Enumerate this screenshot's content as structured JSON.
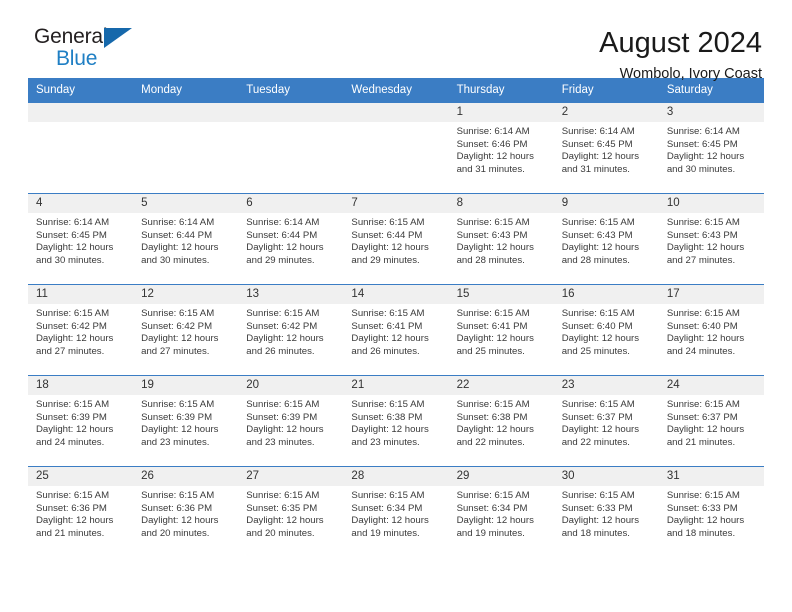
{
  "brand": {
    "name_top": "General",
    "name_bottom": "Blue",
    "triangle_color": "#1668ab",
    "blue_text_color": "#1f7fc4"
  },
  "header": {
    "title": "August 2024",
    "subtitle": "Wombolo, Ivory Coast",
    "accent_color": "#3b7dc4",
    "header_text_color": "#ffffff",
    "daynum_bg": "#f0f0f0"
  },
  "calendar": {
    "weekday_headers": [
      "Sunday",
      "Monday",
      "Tuesday",
      "Wednesday",
      "Thursday",
      "Friday",
      "Saturday"
    ],
    "weeks": [
      [
        {
          "day": "",
          "lines": []
        },
        {
          "day": "",
          "lines": []
        },
        {
          "day": "",
          "lines": []
        },
        {
          "day": "",
          "lines": []
        },
        {
          "day": "1",
          "lines": [
            "Sunrise: 6:14 AM",
            "Sunset: 6:46 PM",
            "Daylight: 12 hours",
            "and 31 minutes."
          ]
        },
        {
          "day": "2",
          "lines": [
            "Sunrise: 6:14 AM",
            "Sunset: 6:45 PM",
            "Daylight: 12 hours",
            "and 31 minutes."
          ]
        },
        {
          "day": "3",
          "lines": [
            "Sunrise: 6:14 AM",
            "Sunset: 6:45 PM",
            "Daylight: 12 hours",
            "and 30 minutes."
          ]
        }
      ],
      [
        {
          "day": "4",
          "lines": [
            "Sunrise: 6:14 AM",
            "Sunset: 6:45 PM",
            "Daylight: 12 hours",
            "and 30 minutes."
          ]
        },
        {
          "day": "5",
          "lines": [
            "Sunrise: 6:14 AM",
            "Sunset: 6:44 PM",
            "Daylight: 12 hours",
            "and 30 minutes."
          ]
        },
        {
          "day": "6",
          "lines": [
            "Sunrise: 6:14 AM",
            "Sunset: 6:44 PM",
            "Daylight: 12 hours",
            "and 29 minutes."
          ]
        },
        {
          "day": "7",
          "lines": [
            "Sunrise: 6:15 AM",
            "Sunset: 6:44 PM",
            "Daylight: 12 hours",
            "and 29 minutes."
          ]
        },
        {
          "day": "8",
          "lines": [
            "Sunrise: 6:15 AM",
            "Sunset: 6:43 PM",
            "Daylight: 12 hours",
            "and 28 minutes."
          ]
        },
        {
          "day": "9",
          "lines": [
            "Sunrise: 6:15 AM",
            "Sunset: 6:43 PM",
            "Daylight: 12 hours",
            "and 28 minutes."
          ]
        },
        {
          "day": "10",
          "lines": [
            "Sunrise: 6:15 AM",
            "Sunset: 6:43 PM",
            "Daylight: 12 hours",
            "and 27 minutes."
          ]
        }
      ],
      [
        {
          "day": "11",
          "lines": [
            "Sunrise: 6:15 AM",
            "Sunset: 6:42 PM",
            "Daylight: 12 hours",
            "and 27 minutes."
          ]
        },
        {
          "day": "12",
          "lines": [
            "Sunrise: 6:15 AM",
            "Sunset: 6:42 PM",
            "Daylight: 12 hours",
            "and 27 minutes."
          ]
        },
        {
          "day": "13",
          "lines": [
            "Sunrise: 6:15 AM",
            "Sunset: 6:42 PM",
            "Daylight: 12 hours",
            "and 26 minutes."
          ]
        },
        {
          "day": "14",
          "lines": [
            "Sunrise: 6:15 AM",
            "Sunset: 6:41 PM",
            "Daylight: 12 hours",
            "and 26 minutes."
          ]
        },
        {
          "day": "15",
          "lines": [
            "Sunrise: 6:15 AM",
            "Sunset: 6:41 PM",
            "Daylight: 12 hours",
            "and 25 minutes."
          ]
        },
        {
          "day": "16",
          "lines": [
            "Sunrise: 6:15 AM",
            "Sunset: 6:40 PM",
            "Daylight: 12 hours",
            "and 25 minutes."
          ]
        },
        {
          "day": "17",
          "lines": [
            "Sunrise: 6:15 AM",
            "Sunset: 6:40 PM",
            "Daylight: 12 hours",
            "and 24 minutes."
          ]
        }
      ],
      [
        {
          "day": "18",
          "lines": [
            "Sunrise: 6:15 AM",
            "Sunset: 6:39 PM",
            "Daylight: 12 hours",
            "and 24 minutes."
          ]
        },
        {
          "day": "19",
          "lines": [
            "Sunrise: 6:15 AM",
            "Sunset: 6:39 PM",
            "Daylight: 12 hours",
            "and 23 minutes."
          ]
        },
        {
          "day": "20",
          "lines": [
            "Sunrise: 6:15 AM",
            "Sunset: 6:39 PM",
            "Daylight: 12 hours",
            "and 23 minutes."
          ]
        },
        {
          "day": "21",
          "lines": [
            "Sunrise: 6:15 AM",
            "Sunset: 6:38 PM",
            "Daylight: 12 hours",
            "and 23 minutes."
          ]
        },
        {
          "day": "22",
          "lines": [
            "Sunrise: 6:15 AM",
            "Sunset: 6:38 PM",
            "Daylight: 12 hours",
            "and 22 minutes."
          ]
        },
        {
          "day": "23",
          "lines": [
            "Sunrise: 6:15 AM",
            "Sunset: 6:37 PM",
            "Daylight: 12 hours",
            "and 22 minutes."
          ]
        },
        {
          "day": "24",
          "lines": [
            "Sunrise: 6:15 AM",
            "Sunset: 6:37 PM",
            "Daylight: 12 hours",
            "and 21 minutes."
          ]
        }
      ],
      [
        {
          "day": "25",
          "lines": [
            "Sunrise: 6:15 AM",
            "Sunset: 6:36 PM",
            "Daylight: 12 hours",
            "and 21 minutes."
          ]
        },
        {
          "day": "26",
          "lines": [
            "Sunrise: 6:15 AM",
            "Sunset: 6:36 PM",
            "Daylight: 12 hours",
            "and 20 minutes."
          ]
        },
        {
          "day": "27",
          "lines": [
            "Sunrise: 6:15 AM",
            "Sunset: 6:35 PM",
            "Daylight: 12 hours",
            "and 20 minutes."
          ]
        },
        {
          "day": "28",
          "lines": [
            "Sunrise: 6:15 AM",
            "Sunset: 6:34 PM",
            "Daylight: 12 hours",
            "and 19 minutes."
          ]
        },
        {
          "day": "29",
          "lines": [
            "Sunrise: 6:15 AM",
            "Sunset: 6:34 PM",
            "Daylight: 12 hours",
            "and 19 minutes."
          ]
        },
        {
          "day": "30",
          "lines": [
            "Sunrise: 6:15 AM",
            "Sunset: 6:33 PM",
            "Daylight: 12 hours",
            "and 18 minutes."
          ]
        },
        {
          "day": "31",
          "lines": [
            "Sunrise: 6:15 AM",
            "Sunset: 6:33 PM",
            "Daylight: 12 hours",
            "and 18 minutes."
          ]
        }
      ]
    ]
  }
}
